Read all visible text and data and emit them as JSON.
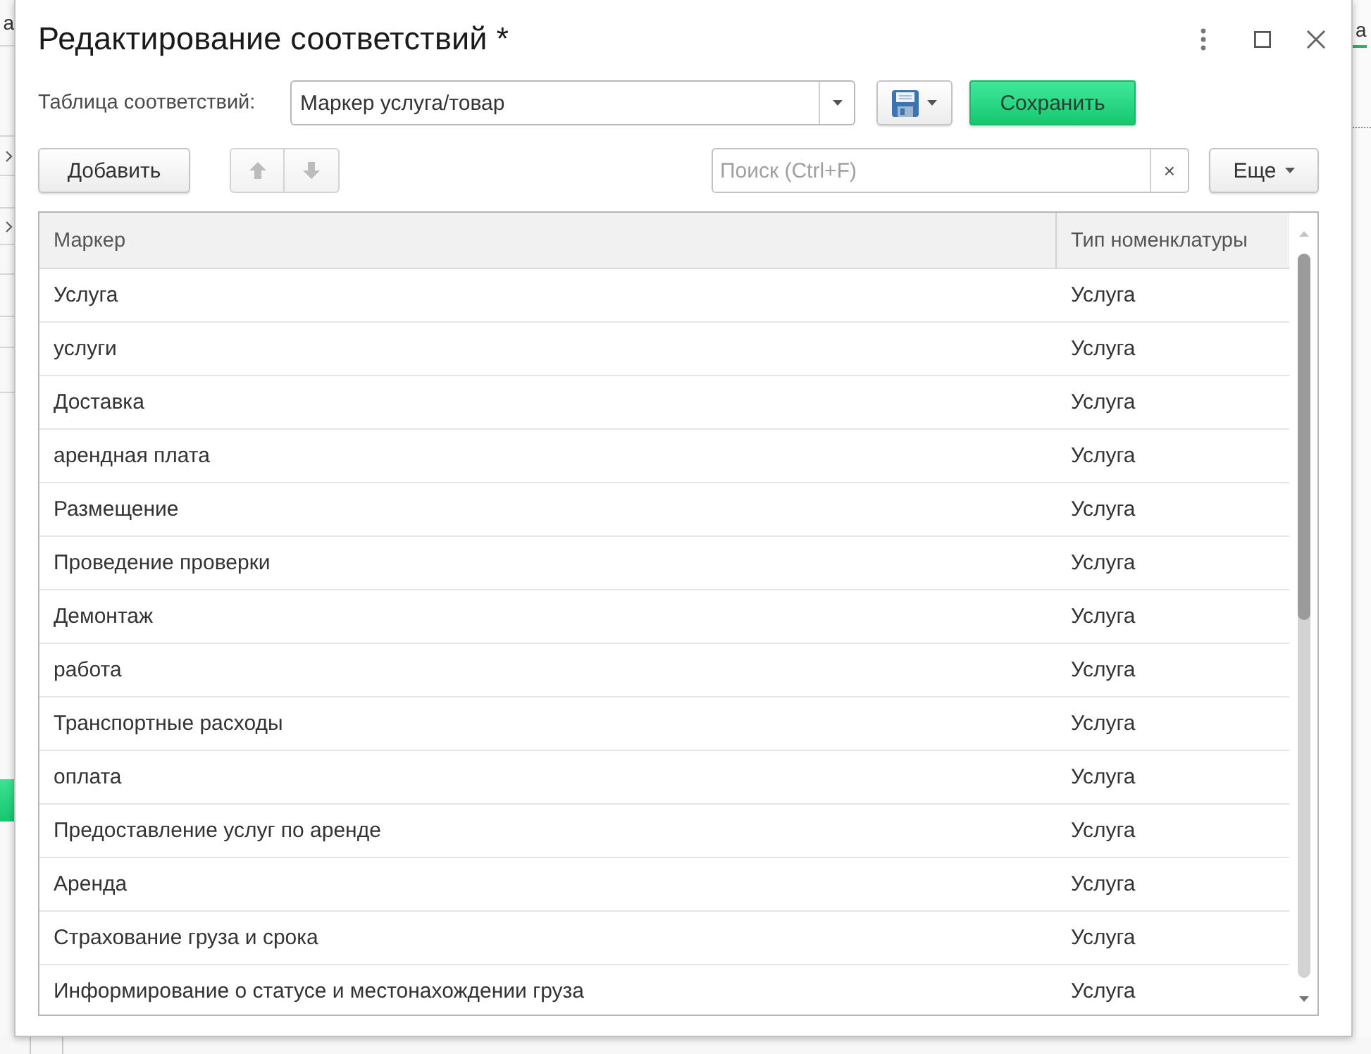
{
  "background": {
    "left_fragment": "а",
    "right_fragment": "а"
  },
  "window": {
    "title": "Редактирование соответствий *"
  },
  "table_selector": {
    "label": "Таблица соответствий:",
    "value": "Маркер услуга/товар"
  },
  "toolbar": {
    "save_button": "Сохранить",
    "add_button": "Добавить",
    "move_buttons": [
      {
        "kind": "up",
        "disabled": true
      },
      {
        "kind": "down",
        "disabled": true
      }
    ],
    "search": {
      "placeholder": "Поиск (Ctrl+F)",
      "clear": "×"
    },
    "more_button": "Еще"
  },
  "table": {
    "columns": [
      "Маркер",
      "Тип номенклатуры"
    ],
    "rows": [
      {
        "marker": "Услуга",
        "item_type": "Услуга"
      },
      {
        "marker": "услуги",
        "item_type": "Услуга"
      },
      {
        "marker": "Доставка",
        "item_type": "Услуга"
      },
      {
        "marker": "арендная плата",
        "item_type": "Услуга"
      },
      {
        "marker": "Размещение",
        "item_type": "Услуга"
      },
      {
        "marker": "Проведение проверки",
        "item_type": "Услуга"
      },
      {
        "marker": "Демонтаж",
        "item_type": "Услуга"
      },
      {
        "marker": "работа",
        "item_type": "Услуга"
      },
      {
        "marker": "Транспортные расходы",
        "item_type": "Услуга"
      },
      {
        "marker": "оплата",
        "item_type": "Услуга"
      },
      {
        "marker": "Предоставление услуг по аренде",
        "item_type": "Услуга"
      },
      {
        "marker": "Аренда",
        "item_type": "Услуга"
      },
      {
        "marker": "Страхование груза и срока",
        "item_type": "Услуга"
      },
      {
        "marker": "Информирование о статусе и местонахождении груза",
        "item_type": "Услуга"
      }
    ]
  }
}
